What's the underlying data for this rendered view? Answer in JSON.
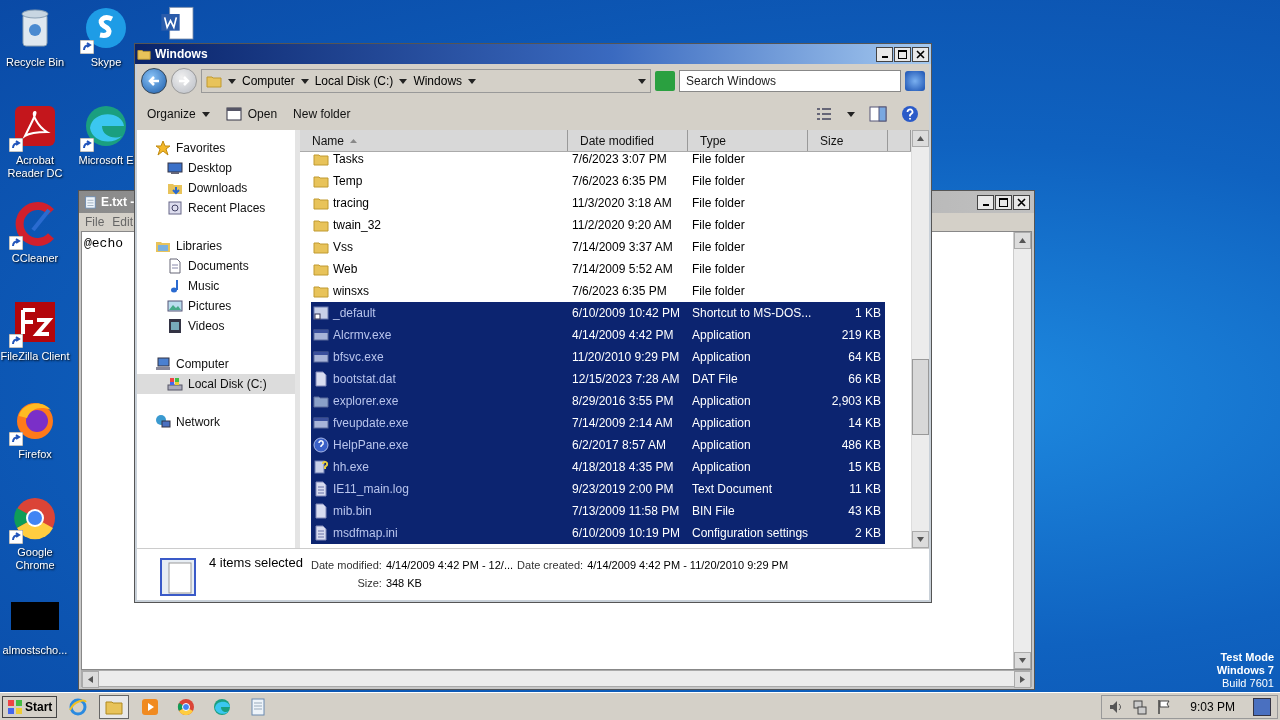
{
  "desktop": {
    "icon_columns": [
      [
        {
          "label": "Recycle Bin",
          "kind": "recycle",
          "shortcut": false
        },
        {
          "label": "Acrobat Reader DC",
          "kind": "acrobat",
          "shortcut": true
        },
        {
          "label": "CCleaner",
          "kind": "ccleaner",
          "shortcut": true
        },
        {
          "label": "FileZilla Client",
          "kind": "filezilla",
          "shortcut": true
        },
        {
          "label": "Firefox",
          "kind": "firefox",
          "shortcut": true
        },
        {
          "label": "Google Chrome",
          "kind": "chrome",
          "shortcut": true
        },
        {
          "label": "almostscho...",
          "kind": "blank",
          "shortcut": false
        }
      ],
      [
        {
          "label": "Skype",
          "kind": "skype",
          "shortcut": true
        },
        {
          "label": "Microsoft E",
          "kind": "edge",
          "shortcut": true
        }
      ],
      [
        {
          "kind": "word",
          "shortcut": false
        }
      ]
    ],
    "os_notice": [
      "Test Mode",
      "Windows 7",
      "Build 7601"
    ]
  },
  "notepad": {
    "title": "E.txt -",
    "menu": [
      "File",
      "Edit"
    ],
    "text": "@echo"
  },
  "explorer": {
    "title": "Windows",
    "breadcrumb": [
      "Computer",
      "Local Disk (C:)",
      "Windows"
    ],
    "search": {
      "placeholder": "Search Windows"
    },
    "toolbar": [
      {
        "label": "Organize",
        "kind": "menu"
      },
      {
        "label": "Open",
        "kind": "open"
      },
      {
        "label": "New folder",
        "kind": "plain"
      }
    ],
    "nav": [
      {
        "label": "Favorites",
        "kind": "star",
        "selected": false,
        "children": [
          {
            "label": "Desktop",
            "kind": "desktop",
            "selected": false
          },
          {
            "label": "Downloads",
            "kind": "downloads",
            "selected": false
          },
          {
            "label": "Recent Places",
            "kind": "recent",
            "selected": false
          }
        ]
      },
      {
        "label": "Libraries",
        "kind": "libraries",
        "selected": false,
        "children": [
          {
            "label": "Documents",
            "kind": "documents",
            "selected": false
          },
          {
            "label": "Music",
            "kind": "music",
            "selected": false
          },
          {
            "label": "Pictures",
            "kind": "pictures",
            "selected": false
          },
          {
            "label": "Videos",
            "kind": "videos",
            "selected": false
          }
        ]
      },
      {
        "label": "Computer",
        "kind": "computer",
        "selected": false,
        "children": [
          {
            "label": "Local Disk (C:)",
            "kind": "disk",
            "selected": true
          }
        ]
      },
      {
        "label": "Network",
        "kind": "network",
        "selected": false
      }
    ],
    "columns": [
      {
        "label": "Name",
        "sorted": true
      },
      {
        "label": "Date modified",
        "sorted": false
      },
      {
        "label": "Type",
        "sorted": false
      },
      {
        "label": "Size",
        "sorted": false
      }
    ],
    "rows": [
      {
        "name": "Tasks",
        "date": "7/6/2023 3:07 PM",
        "type": "File folder",
        "kind": "folder",
        "selected": false
      },
      {
        "name": "Temp",
        "date": "7/6/2023 6:35 PM",
        "type": "File folder",
        "kind": "folder",
        "selected": false
      },
      {
        "name": "tracing",
        "date": "11/3/2020 3:18 AM",
        "type": "File folder",
        "kind": "folder",
        "selected": false
      },
      {
        "name": "twain_32",
        "date": "11/2/2020 9:20 AM",
        "type": "File folder",
        "kind": "folder",
        "selected": false
      },
      {
        "name": "Vss",
        "date": "7/14/2009 3:37 AM",
        "type": "File folder",
        "kind": "folder",
        "selected": false
      },
      {
        "name": "Web",
        "date": "7/14/2009 5:52 AM",
        "type": "File folder",
        "kind": "folder",
        "selected": false
      },
      {
        "name": "winsxs",
        "date": "7/6/2023 6:35 PM",
        "type": "File folder",
        "kind": "folder",
        "selected": false
      },
      {
        "name": "_default",
        "date": "6/10/2009 10:42 PM",
        "type": "Shortcut to MS-DOS...",
        "size": "1 KB",
        "kind": "shortcut",
        "selected": true
      },
      {
        "name": "Alcrmv.exe",
        "date": "4/14/2009 4:42 PM",
        "type": "Application",
        "size": "219 KB",
        "kind": "app",
        "selected": true
      },
      {
        "name": "bfsvc.exe",
        "date": "11/20/2010 9:29 PM",
        "type": "Application",
        "size": "64 KB",
        "kind": "app",
        "selected": true
      },
      {
        "name": "bootstat.dat",
        "date": "12/15/2023 7:28 AM",
        "type": "DAT File",
        "size": "66 KB",
        "kind": "file",
        "selected": true
      },
      {
        "name": "explorer.exe",
        "date": "8/29/2016 3:55 PM",
        "type": "Application",
        "size": "2,903 KB",
        "kind": "explorer",
        "selected": true
      },
      {
        "name": "fveupdate.exe",
        "date": "7/14/2009 2:14 AM",
        "type": "Application",
        "size": "14 KB",
        "kind": "app",
        "selected": true
      },
      {
        "name": "HelpPane.exe",
        "date": "6/2/2017 8:57 AM",
        "type": "Application",
        "size": "486 KB",
        "kind": "help",
        "selected": true
      },
      {
        "name": "hh.exe",
        "date": "4/18/2018 4:35 PM",
        "type": "Application",
        "size": "15 KB",
        "kind": "hh",
        "selected": true
      },
      {
        "name": "IE11_main.log",
        "date": "9/23/2019 2:00 PM",
        "type": "Text Document",
        "size": "11 KB",
        "kind": "text",
        "selected": true
      },
      {
        "name": "mib.bin",
        "date": "7/13/2009 11:58 PM",
        "type": "BIN File",
        "size": "43 KB",
        "kind": "file",
        "selected": true
      },
      {
        "name": "msdfmap.ini",
        "date": "6/10/2009 10:19 PM",
        "type": "Configuration settings",
        "size": "2 KB",
        "kind": "text",
        "selected": true
      }
    ],
    "details": {
      "summary": "4 items selected",
      "fields": [
        {
          "label": "Date modified:",
          "value": "4/14/2009 4:42 PM - 12/..."
        },
        {
          "label": "Date created:",
          "value": "4/14/2009 4:42 PM - 11/20/2010 9:29 PM"
        },
        {
          "label": "Size:",
          "value": "348 KB"
        }
      ]
    }
  },
  "taskbar": {
    "start": "Start",
    "apps": [
      {
        "kind": "ie",
        "active": false
      },
      {
        "kind": "explorer",
        "active": true
      },
      {
        "kind": "media",
        "active": false
      },
      {
        "kind": "chrome",
        "active": false
      },
      {
        "kind": "edge",
        "active": false
      },
      {
        "kind": "notepad",
        "active": false
      }
    ],
    "clock": "9:03 PM"
  }
}
